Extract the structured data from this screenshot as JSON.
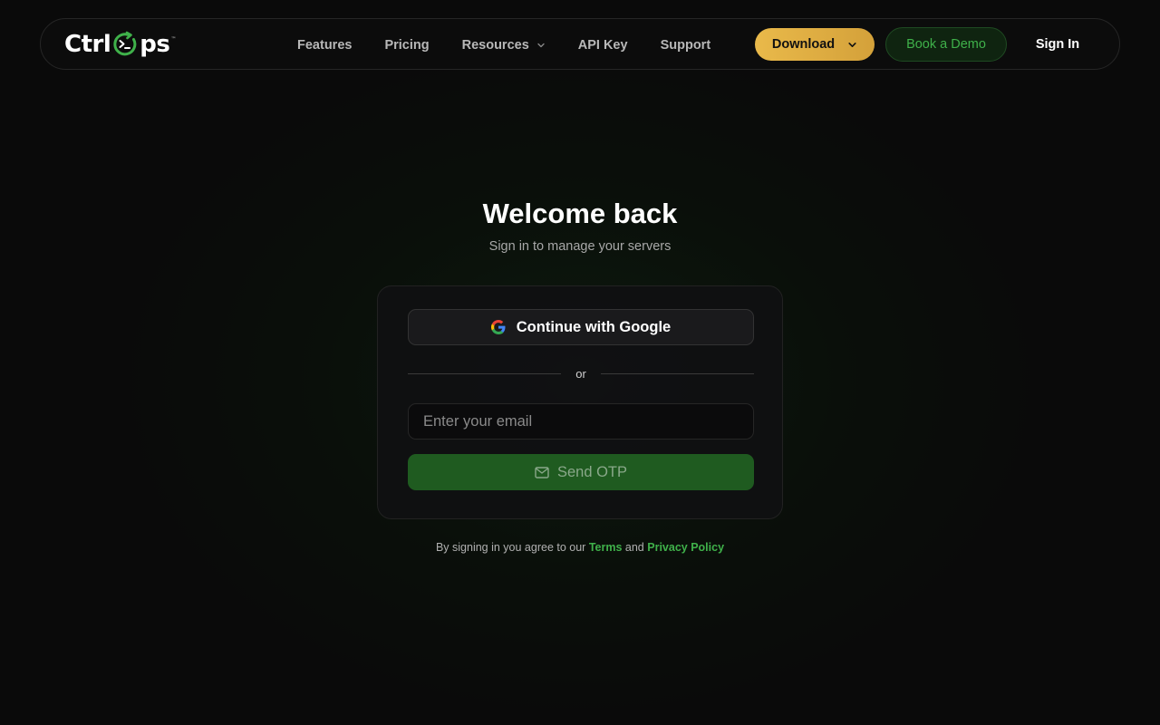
{
  "brand": {
    "logo_prefix": "Ctrl",
    "logo_suffix": "ps",
    "trademark": "™",
    "accent_color": "#3fb14a"
  },
  "nav": {
    "links": [
      {
        "label": "Features"
      },
      {
        "label": "Pricing"
      },
      {
        "label": "Resources",
        "icon": "chevron-down-icon"
      },
      {
        "label": "API Key"
      },
      {
        "label": "Support"
      }
    ],
    "download_label": "Download",
    "demo_label": "Book a Demo",
    "signin_label": "Sign In",
    "download_color": "#e9b94a"
  },
  "hero": {
    "title": "Welcome back",
    "subtitle": "Sign in to manage your servers"
  },
  "card": {
    "google_label": "Continue with Google",
    "divider_text": "or",
    "email_placeholder": "Enter your email",
    "email_value": "",
    "otp_label": "Send OTP",
    "otp_icon": "mail-icon"
  },
  "legal": {
    "prefix": "By signing in you agree to our",
    "terms": "Terms",
    "conjunction": "and",
    "privacy": "Privacy Policy"
  }
}
